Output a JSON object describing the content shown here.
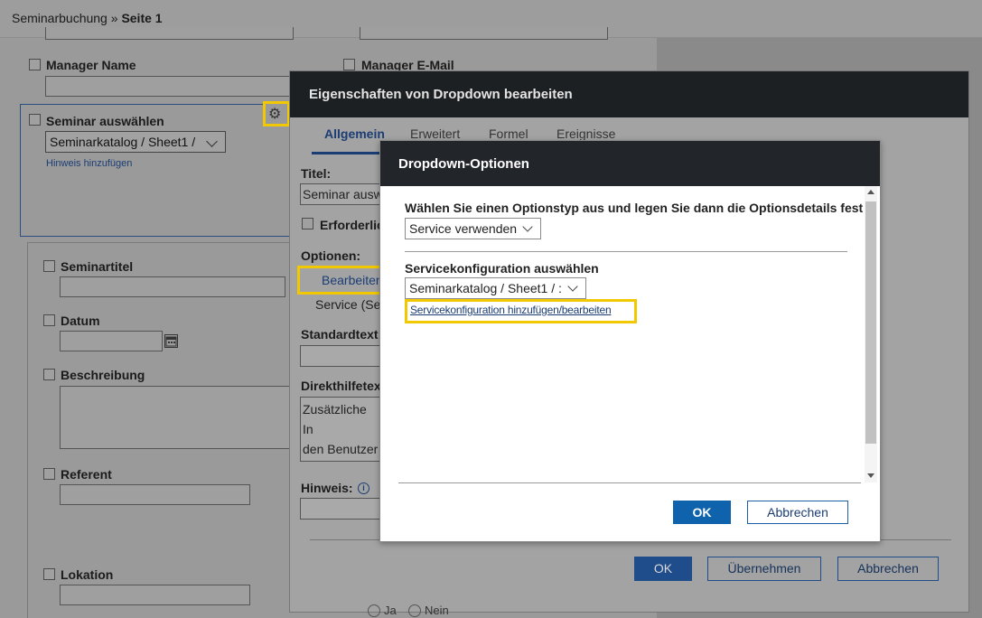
{
  "breadcrumb": {
    "parent": "Seminarbuchung",
    "separator": " » ",
    "current": "Seite 1"
  },
  "form": {
    "manager_name_label": "Manager Name",
    "manager_email_label": "Manager E-Mail",
    "seminar_select_label": "Seminar auswählen",
    "seminar_select_value": "Seminarkatalog / Sheet1 /",
    "hint_link": "Hinweis hinzufügen",
    "fields": [
      "Seminartitel",
      "Datum",
      "Beschreibung",
      "Referent",
      "Lokation"
    ],
    "radio_yes": "Ja",
    "radio_no": "Nein"
  },
  "properties_dialog": {
    "title": "Eigenschaften von Dropdown bearbeiten",
    "tabs": [
      "Allgemein",
      "Erweitert",
      "Formel",
      "Ereignisse"
    ],
    "active_tab": "Allgemein",
    "titel_label": "Titel:",
    "titel_value": "Seminar ausw",
    "required_label": "Erforderlic",
    "options_label": "Optionen:",
    "edit_button": "Bearbeiten",
    "options_source": "Service (Ser",
    "default_text_label": "Standardtext:",
    "help_text_label": "Direkthilfetext",
    "help_text_value_line1": "Zusätzliche In",
    "help_text_value_line2": "den Benutzer h",
    "hint_label": "Hinweis:",
    "info_icon": "i",
    "ok_button": "OK",
    "apply_button": "Übernehmen",
    "cancel_button": "Abbrechen"
  },
  "dropdown_options_dialog": {
    "title": "Dropdown-Optionen",
    "type_label": "Wählen Sie einen Optionstyp aus und legen Sie dann die Optionsdetails fest",
    "type_value": "Service verwenden",
    "service_config_label": "Servicekonfiguration auswählen",
    "service_config_value": "Seminarkatalog / Sheet1 / :",
    "add_edit_link": "Servicekonfiguration hinzufügen/bearbeiten",
    "ok_button": "OK",
    "cancel_button": "Abbrechen"
  },
  "colors": {
    "highlight": "#f2c800",
    "primary": "#0f62ac",
    "header_dark": "#22262b"
  }
}
